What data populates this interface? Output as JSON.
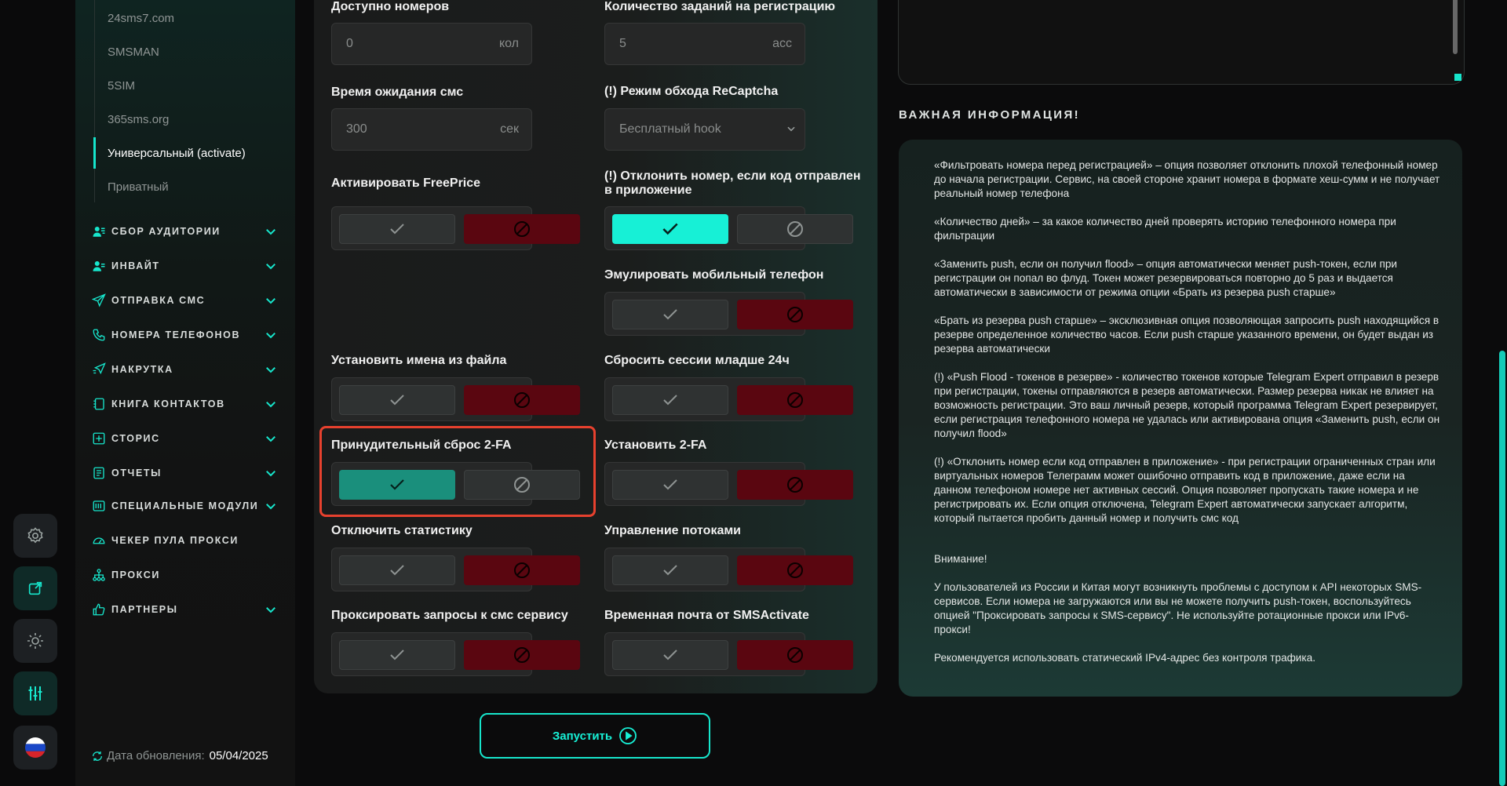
{
  "sidebar": {
    "providers": [
      "24sms7.com",
      "SMSMAN",
      "5SIM",
      "365sms.org",
      "Универсальный (activate)",
      "Приватный"
    ],
    "categories": [
      "СБОР АУДИТОРИИ",
      "ИНВАЙТ",
      "ОТПРАВКА СМС",
      "НОМЕРА ТЕЛЕФОНОВ",
      "НАКРУТКА",
      "КНИГА КОНТАКТОВ",
      "СТОРИС",
      "ОТЧЕТЫ",
      "СПЕЦИАЛЬНЫЕ МОДУЛИ",
      "ЧЕКЕР ПУЛА ПРОКСИ",
      "ПРОКСИ",
      "ПАРТНЕРЫ"
    ],
    "update_label": "Дата обновления:",
    "update_value": "05/04/2025"
  },
  "form": {
    "available_label": "Доступно номеров",
    "available_value": "0",
    "available_unit": "кол",
    "tasks_label": "Количество заданий на регистрацию",
    "tasks_value": "5",
    "tasks_unit": "acc",
    "wait_label": "Время ожидания смс",
    "wait_value": "300",
    "wait_unit": "сек",
    "recaptcha_label": "(!) Режим обхода ReCaptcha",
    "recaptcha_value": "Бесплатный hook",
    "freeprice_label": "Активировать FreePrice",
    "reject_label": "(!) Отклонить номер, если код отправлен в приложение",
    "emulate_label": "Эмулировать мобильный телефон",
    "names_label": "Установить имена из файла",
    "reset_sessions_label": "Сбросить сессии младше 24ч",
    "force_2fa_label": "Принудительный сброс 2-FA",
    "set_2fa_label": "Установить 2-FA",
    "stats_label": "Отключить статистику",
    "threads_label": "Управление потоками",
    "proxy_sms_label": "Проксировать запросы к смс сервису",
    "temp_mail_label": "Временная почта от SMSActivate"
  },
  "run_label": "Запустить",
  "info": {
    "title": "ВАЖНАЯ ИНФОРМАЦИЯ!",
    "p1": "«Фильтровать номера перед регистрацией» – опция позволяет отклонить плохой телефонный номер до начала регистрации. Сервис, на своей стороне хранит номера в формате хеш-сумм и не получает реальный номер телефона",
    "p2": "«Количество дней» – за какое количество дней проверять историю телефонного номера при фильтрации",
    "p3": "«Заменить push, если он получил flood» – опция автоматически меняет push-токен, если при регистрации он попал во флуд. Токен может резервироваться повторно до 5 раз и выдается автоматически в зависимости от режима опции «Брать из резерва push старше»",
    "p4": "«Брать из резерва push старше» – эксклюзивная опция позволяющая запросить push находящийся в резерве определенное количество часов. Если push старше указанного времени, он будет выдан из резерва автоматически",
    "p5": "(!) «Push Flood - токенов в резерве» - количество токенов которые Telegram Expert отправил в резерв при регистрации, токены отправляются в резерв автоматически. Размер резерва никак не влияет на возможность регистрации. Это ваш личный резерв, который программа Telegram Expert резервирует, если регистрация телефонного номера не удалась или активирована опция «Заменить push, если он получил flood»",
    "p6": "(!) «Отклонить номер если код отправлен в приложение» - при регистрации ограниченных стран или виртуальных номеров Телеграмм может ошибочно отправить код в приложение, даже если на данном телефоном номере нет активных сессий. Опция позволяет пропускать такие номера и не регистрировать их. Если опция отключена, Telegram Expert автоматически запускает алгоритм, который пытается пробить данный номер и получить смс код",
    "p7": "Внимание!",
    "p8": "У пользователей из России и Китая могут возникнуть проблемы с доступом к API некоторых SMS-сервисов. Если номера не загружаются или вы не можете получить push-токен, воспользуйтесь опцией \"Проксировать запросы к SMS-сервису\". Не используйте ротационные прокси или IPv6-прокси!",
    "p9": "Рекомендуется использовать статический IPv4-адрес без контроля трафика."
  }
}
